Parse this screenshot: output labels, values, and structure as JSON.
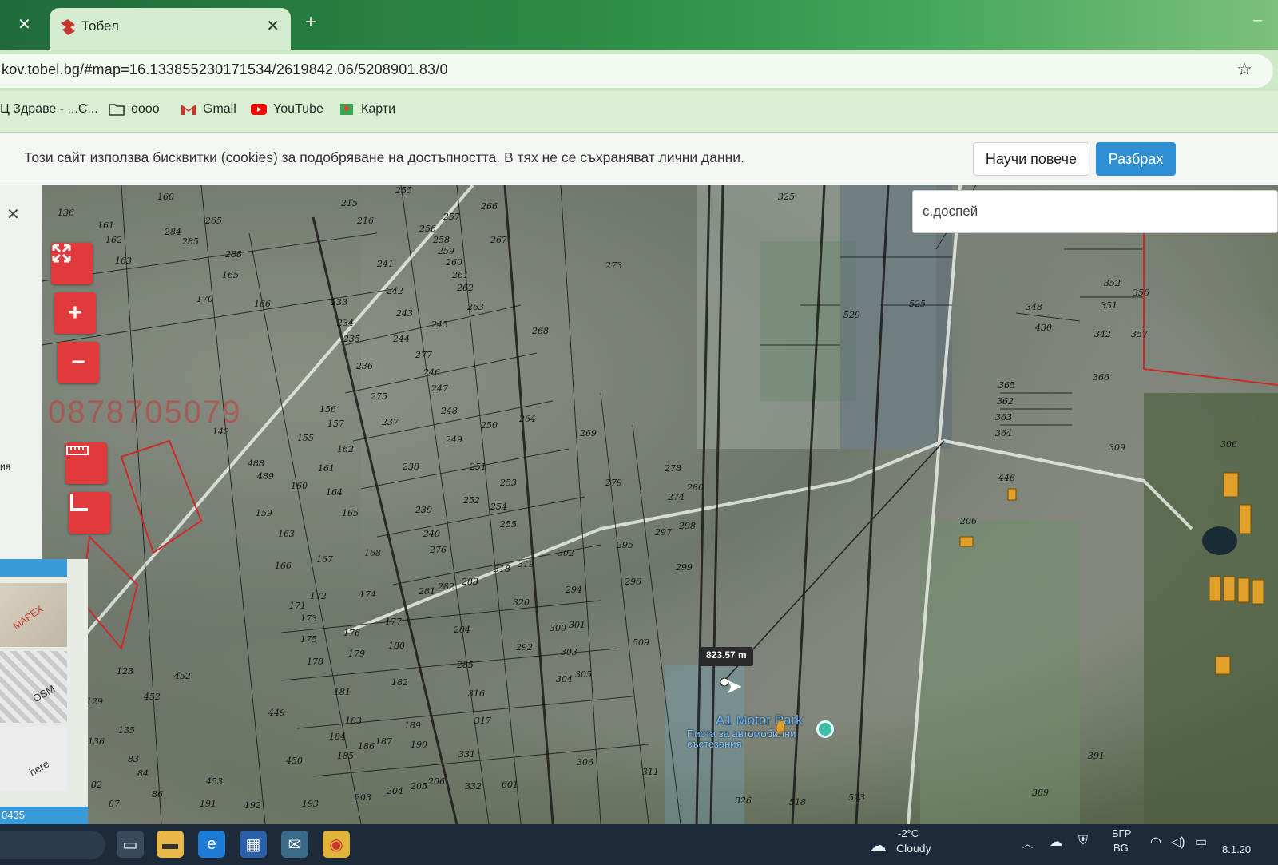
{
  "browser": {
    "tab_title": "Тобел",
    "url": "kov.tobel.bg/#map=16.133855230171534/2619842.06/5208901.83/0",
    "bookmarks": [
      "Ц Здраве - ...С...",
      "oooo",
      "Gmail",
      "YouTube",
      "Карти"
    ]
  },
  "cookie_banner": {
    "text": "Този сайт използва бисквитки (cookies) за подобряване на достъпността. В тях не се съхраняват лични данни.",
    "learn_more": "Научи повече",
    "accept": "Разбрах"
  },
  "search": {
    "value": "с.доспей"
  },
  "side_panel": {
    "label": "ия",
    "thumb_label_1": "МАРЕХ",
    "thumb_label_2": "OSM",
    "thumb_label_3": "here",
    "code": "0435"
  },
  "map": {
    "watermark": "0878705079",
    "measure_label": "823.57 m",
    "poi_title": "A1 Motor Park",
    "poi_subtitle": "Писта за автомобилни състезания",
    "parcels": [
      {
        "n": "136"
      },
      {
        "n": "161"
      },
      {
        "n": "160"
      },
      {
        "n": "265"
      },
      {
        "n": "215"
      },
      {
        "n": "216"
      },
      {
        "n": "255"
      },
      {
        "n": "266"
      },
      {
        "n": "257"
      },
      {
        "n": "256"
      },
      {
        "n": "258"
      },
      {
        "n": "259"
      },
      {
        "n": "260"
      },
      {
        "n": "261"
      },
      {
        "n": "262"
      },
      {
        "n": "263"
      },
      {
        "n": "267"
      },
      {
        "n": "273"
      },
      {
        "n": "325"
      },
      {
        "n": "162"
      },
      {
        "n": "163"
      },
      {
        "n": "284"
      },
      {
        "n": "285"
      },
      {
        "n": "288"
      },
      {
        "n": "165"
      },
      {
        "n": "241"
      },
      {
        "n": "242"
      },
      {
        "n": "243"
      },
      {
        "n": "244"
      },
      {
        "n": "245"
      },
      {
        "n": "170"
      },
      {
        "n": "166"
      },
      {
        "n": "233"
      },
      {
        "n": "234"
      },
      {
        "n": "235"
      },
      {
        "n": "236"
      },
      {
        "n": "268"
      },
      {
        "n": "277"
      },
      {
        "n": "246"
      },
      {
        "n": "247"
      },
      {
        "n": "248"
      },
      {
        "n": "249"
      },
      {
        "n": "250"
      },
      {
        "n": "264"
      },
      {
        "n": "269"
      },
      {
        "n": "275"
      },
      {
        "n": "237"
      },
      {
        "n": "238"
      },
      {
        "n": "251"
      },
      {
        "n": "252"
      },
      {
        "n": "253"
      },
      {
        "n": "254"
      },
      {
        "n": "255"
      },
      {
        "n": "239"
      },
      {
        "n": "240"
      },
      {
        "n": "276"
      },
      {
        "n": "278"
      },
      {
        "n": "279"
      },
      {
        "n": "280"
      },
      {
        "n": "274"
      },
      {
        "n": "297"
      },
      {
        "n": "298"
      },
      {
        "n": "295"
      },
      {
        "n": "296"
      },
      {
        "n": "299"
      },
      {
        "n": "302"
      },
      {
        "n": "318"
      },
      {
        "n": "319"
      },
      {
        "n": "320"
      },
      {
        "n": "294"
      },
      {
        "n": "281"
      },
      {
        "n": "282"
      },
      {
        "n": "283"
      },
      {
        "n": "284"
      },
      {
        "n": "285"
      },
      {
        "n": "316"
      },
      {
        "n": "317"
      },
      {
        "n": "142"
      },
      {
        "n": "155"
      },
      {
        "n": "156"
      },
      {
        "n": "157"
      },
      {
        "n": "162"
      },
      {
        "n": "161"
      },
      {
        "n": "164"
      },
      {
        "n": "165"
      },
      {
        "n": "160"
      },
      {
        "n": "159"
      },
      {
        "n": "163"
      },
      {
        "n": "488"
      },
      {
        "n": "489"
      },
      {
        "n": "167"
      },
      {
        "n": "168"
      },
      {
        "n": "166"
      },
      {
        "n": "174"
      },
      {
        "n": "177"
      },
      {
        "n": "176"
      },
      {
        "n": "180"
      },
      {
        "n": "179"
      },
      {
        "n": "175"
      },
      {
        "n": "178"
      },
      {
        "n": "173"
      },
      {
        "n": "172"
      },
      {
        "n": "171"
      },
      {
        "n": "181"
      },
      {
        "n": "182"
      },
      {
        "n": "183"
      },
      {
        "n": "184"
      },
      {
        "n": "185"
      },
      {
        "n": "186"
      },
      {
        "n": "187"
      },
      {
        "n": "189"
      },
      {
        "n": "190"
      },
      {
        "n": "449"
      },
      {
        "n": "450"
      },
      {
        "n": "452"
      },
      {
        "n": "453"
      },
      {
        "n": "123"
      },
      {
        "n": "129"
      },
      {
        "n": "135"
      },
      {
        "n": "136"
      },
      {
        "n": "83"
      },
      {
        "n": "84"
      },
      {
        "n": "82"
      },
      {
        "n": "86"
      },
      {
        "n": "87"
      },
      {
        "n": "191"
      },
      {
        "n": "192"
      },
      {
        "n": "193"
      },
      {
        "n": "203"
      },
      {
        "n": "204"
      },
      {
        "n": "205"
      },
      {
        "n": "206"
      },
      {
        "n": "331"
      },
      {
        "n": "332"
      },
      {
        "n": "306"
      },
      {
        "n": "311"
      },
      {
        "n": "601"
      },
      {
        "n": "326"
      },
      {
        "n": "518"
      },
      {
        "n": "523"
      },
      {
        "n": "525"
      },
      {
        "n": "529"
      },
      {
        "n": "348"
      },
      {
        "n": "430"
      },
      {
        "n": "351"
      },
      {
        "n": "352"
      },
      {
        "n": "356"
      },
      {
        "n": "342"
      },
      {
        "n": "357"
      },
      {
        "n": "366"
      },
      {
        "n": "365"
      },
      {
        "n": "362"
      },
      {
        "n": "363"
      },
      {
        "n": "364"
      },
      {
        "n": "309"
      },
      {
        "n": "306"
      },
      {
        "n": "446"
      },
      {
        "n": "206"
      },
      {
        "n": "389"
      },
      {
        "n": "391"
      },
      {
        "n": "300"
      },
      {
        "n": "301"
      },
      {
        "n": "303"
      },
      {
        "n": "304"
      },
      {
        "n": "305"
      },
      {
        "n": "292"
      },
      {
        "n": "509"
      },
      {
        "n": "452"
      }
    ]
  },
  "taskbar": {
    "weather_temp": "-2°C",
    "weather_desc": "Cloudy",
    "lang_top": "БГР",
    "lang_bottom": "BG",
    "date": "8.1.20"
  },
  "colors": {
    "accent_red": "#e23a3a",
    "accept_blue": "#2f8fd3",
    "tab_green": "#2c8a45"
  }
}
